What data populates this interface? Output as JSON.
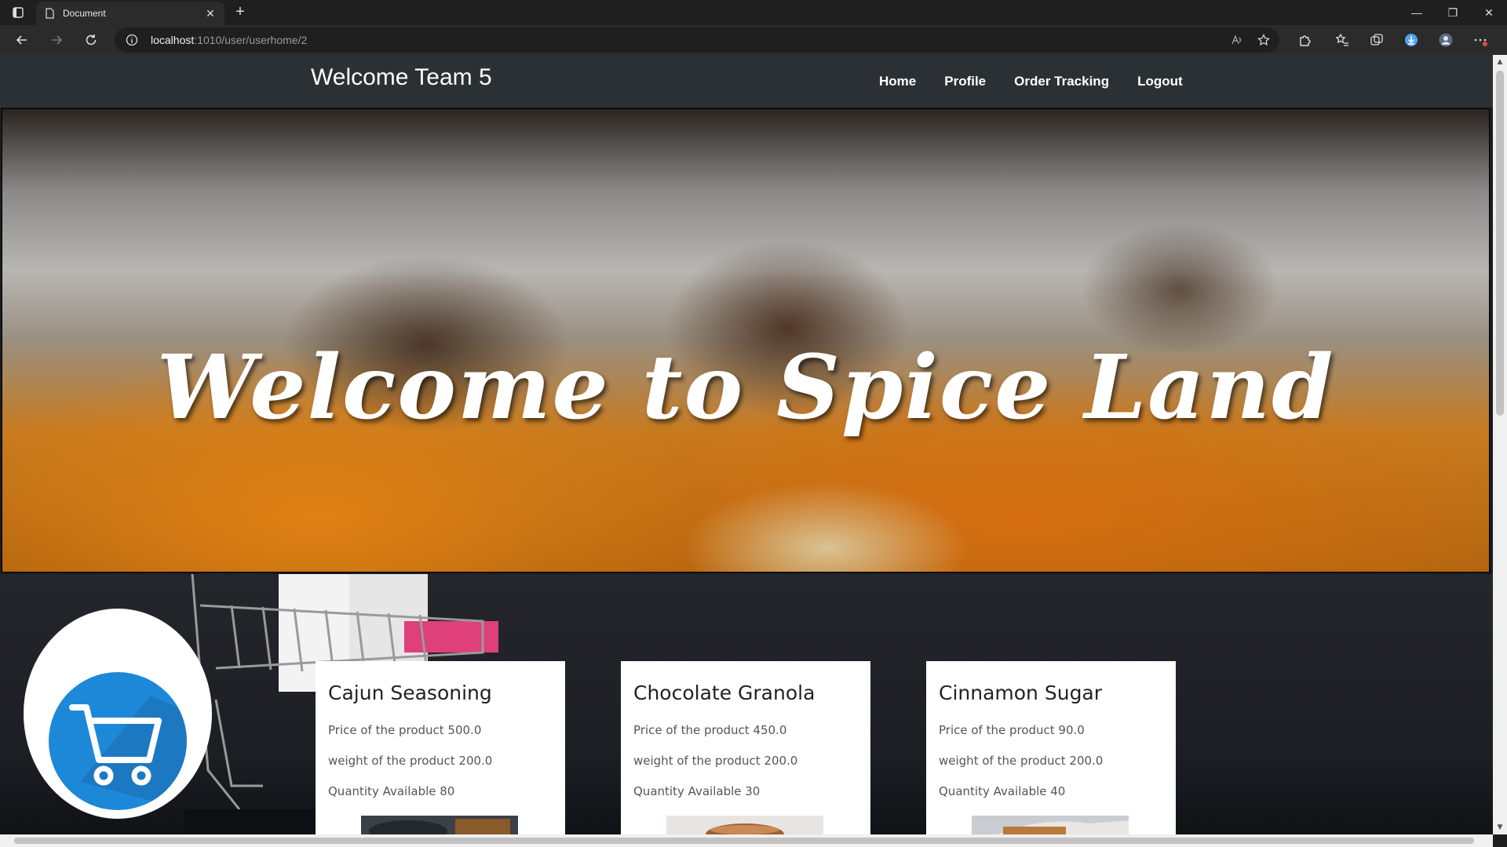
{
  "browser": {
    "tab_title": "Document",
    "tab_close": "✕",
    "new_tab": "+",
    "window_controls": {
      "minimize": "—",
      "restore": "❐",
      "close": "✕"
    },
    "url_host": "localhost",
    "url_path": ":1010/user/userhome/2"
  },
  "site": {
    "brand": "Welcome Team 5",
    "nav": [
      "Home",
      "Profile",
      "Order Tracking",
      "Logout"
    ],
    "hero_title": "Welcome to Spice Land"
  },
  "products": [
    {
      "name": "Cajun Seasoning",
      "price": "Price of the product 500.0",
      "weight": "weight of the product 200.0",
      "quantity": "Quantity Available 80"
    },
    {
      "name": "Chocolate Granola",
      "price": "Price of the product 450.0",
      "weight": "weight of the product 200.0",
      "quantity": "Quantity Available 30"
    },
    {
      "name": "Cinnamon Sugar",
      "price": "Price of the product 90.0",
      "weight": "weight of the product 200.0",
      "quantity": "Quantity Available 40"
    }
  ],
  "colors": {
    "nav_bg": "#2b3035",
    "cart_blue": "#1e88d8"
  }
}
